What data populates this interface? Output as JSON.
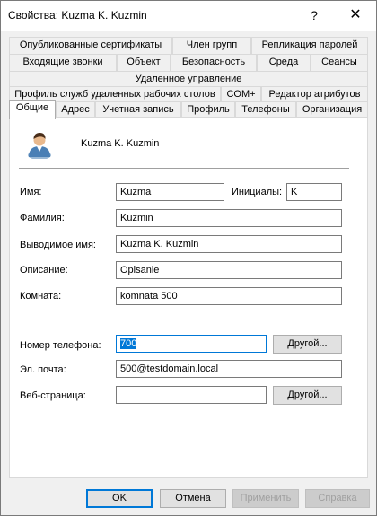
{
  "window": {
    "title": "Свойства: Kuzma K. Kuzmin",
    "help_glyph": "?",
    "close_glyph": "✕"
  },
  "tabs": {
    "row1": [
      "Опубликованные сертификаты",
      "Член групп",
      "Репликация паролей"
    ],
    "row2": [
      "Входящие звонки",
      "Объект",
      "Безопасность",
      "Среда",
      "Сеансы"
    ],
    "row3": [
      "Удаленное управление"
    ],
    "row4": [
      "Профиль служб удаленных рабочих столов",
      "COM+",
      "Редактор атрибутов"
    ],
    "row5": [
      "Общие",
      "Адрес",
      "Учетная запись",
      "Профиль",
      "Телефоны",
      "Организация"
    ],
    "active": "Общие"
  },
  "general": {
    "display_name_header": "Kuzma K. Kuzmin",
    "first_name_label": "Имя:",
    "first_name_value": "Kuzma",
    "initials_label": "Инициалы:",
    "initials_value": "K",
    "last_name_label": "Фамилия:",
    "last_name_value": "Kuzmin",
    "display_name_label": "Выводимое имя:",
    "display_name_value": "Kuzma K. Kuzmin",
    "description_label": "Описание:",
    "description_value": "Opisanie",
    "office_label": "Комната:",
    "office_value": "komnata 500",
    "phone_label": "Номер телефона:",
    "phone_value": "700",
    "email_label": "Эл. почта:",
    "email_value": "500@testdomain.local",
    "web_label": "Веб-страница:",
    "web_value": "",
    "other_button": "Другой..."
  },
  "footer": {
    "ok": "OK",
    "cancel": "Отмена",
    "apply": "Применить",
    "help": "Справка"
  }
}
